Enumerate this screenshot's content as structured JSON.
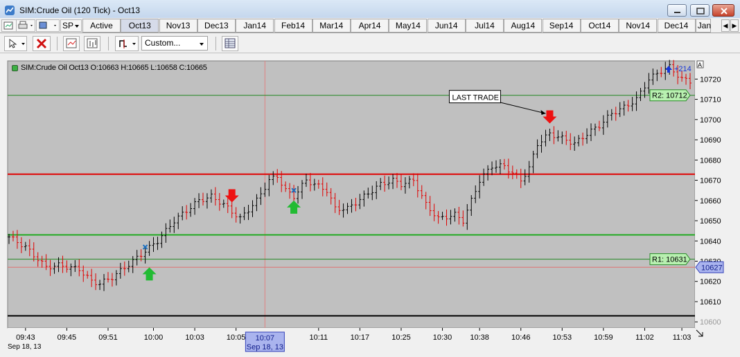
{
  "window": {
    "title": "SIM:Crude Oil (120 Tick) - Oct13"
  },
  "tabs": {
    "instrument": "SP",
    "items": [
      "Active",
      "Oct13",
      "Nov13",
      "Dec13",
      "Jan14",
      "Feb14",
      "Mar14",
      "Apr14",
      "May14",
      "Jun14",
      "Jul14",
      "Aug14",
      "Sep14",
      "Oct14",
      "Nov14",
      "Dec14",
      "Jan"
    ],
    "selected": "Oct13"
  },
  "toolbar": {
    "template_select": "Custom..."
  },
  "chart_header": {
    "instrument": "SIM:Crude Oil Oct13",
    "open_label": "O:",
    "open": "10663",
    "high_label": "H:",
    "high": "10665",
    "low_label": "L:",
    "low": "10658",
    "close_label": "C:",
    "close": "10665"
  },
  "colors": {
    "background": "#c0c0c0",
    "up_bar": "#000000",
    "down_bar": "#e00000",
    "resistance_line": "#e00000",
    "support_line": "#22aa22",
    "pivot_line": "#228822",
    "buy_arrow": "#22bb33",
    "sell_arrow": "#ee1111",
    "price_marker": "#aab4ee"
  },
  "chart_data": {
    "type": "ohlc",
    "ylim": [
      10597,
      10729
    ],
    "y_ticks": [
      10600,
      10610,
      10620,
      10630,
      10640,
      10650,
      10660,
      10670,
      10680,
      10690,
      10700,
      10710,
      10720
    ],
    "x_count": 166,
    "time_ticks": [
      {
        "i": 4,
        "label": "09:43"
      },
      {
        "i": 14,
        "label": "09:45"
      },
      {
        "i": 24,
        "label": "09:51"
      },
      {
        "i": 35,
        "label": "10:00"
      },
      {
        "i": 45,
        "label": "10:03"
      },
      {
        "i": 55,
        "label": "10:05"
      },
      {
        "i": 75,
        "label": "10:11"
      },
      {
        "i": 85,
        "label": "10:17"
      },
      {
        "i": 95,
        "label": "10:25"
      },
      {
        "i": 105,
        "label": "10:30"
      },
      {
        "i": 114,
        "label": "10:38"
      },
      {
        "i": 124,
        "label": "10:46"
      },
      {
        "i": 134,
        "label": "10:53"
      },
      {
        "i": 144,
        "label": "10:59"
      },
      {
        "i": 154,
        "label": "11:02"
      },
      {
        "i": 163,
        "label": "11:03"
      }
    ],
    "date_label": "Sep 18, 13",
    "crosshair": {
      "i": 62,
      "time": "10:07",
      "date": "Sep 18, 13"
    },
    "lines": [
      {
        "name": "R2",
        "value": 10712,
        "label": "R2: 10712",
        "color": "#228822"
      },
      {
        "name": "resistance",
        "value": 10673,
        "color": "#e00000"
      },
      {
        "name": "support",
        "value": 10643,
        "color": "#22aa22"
      },
      {
        "name": "R1",
        "value": 10631,
        "label": "R1: 10631",
        "color": "#228822"
      },
      {
        "name": "crosshair",
        "value": 10627,
        "color": "#e07070"
      },
      {
        "name": "floor",
        "value": 10603,
        "color": "#000000"
      }
    ],
    "last_price": "10627",
    "pnl": "+214",
    "annotation": {
      "text": "LAST TRADE",
      "i": 107,
      "value": 10711,
      "target_i": 130,
      "target_value": 10703
    },
    "buy_arrows": [
      {
        "i": 34,
        "value": 10629
      },
      {
        "i": 69,
        "value": 10662
      }
    ],
    "sell_arrows": [
      {
        "i": 54,
        "value": 10657
      },
      {
        "i": 131,
        "value": 10696
      }
    ],
    "entry_marks": [
      {
        "i": 33,
        "value": 10637
      },
      {
        "i": 69,
        "value": 10665
      }
    ],
    "path_points": [
      [
        0,
        10642
      ],
      [
        4,
        10637
      ],
      [
        9,
        10627
      ],
      [
        12,
        10628
      ],
      [
        17,
        10626
      ],
      [
        20,
        10620
      ],
      [
        22,
        10619
      ],
      [
        25,
        10622
      ],
      [
        30,
        10630
      ],
      [
        36,
        10640
      ],
      [
        40,
        10650
      ],
      [
        43,
        10655
      ],
      [
        46,
        10660
      ],
      [
        49,
        10662
      ],
      [
        52,
        10658
      ],
      [
        56,
        10651
      ],
      [
        60,
        10660
      ],
      [
        63,
        10670
      ],
      [
        65,
        10672
      ],
      [
        67,
        10665
      ],
      [
        69,
        10662
      ],
      [
        72,
        10670
      ],
      [
        74,
        10668
      ],
      [
        77,
        10665
      ],
      [
        79,
        10656
      ],
      [
        82,
        10656
      ],
      [
        86,
        10662
      ],
      [
        90,
        10668
      ],
      [
        93,
        10670
      ],
      [
        95,
        10668
      ],
      [
        98,
        10670
      ],
      [
        101,
        10658
      ],
      [
        104,
        10651
      ],
      [
        108,
        10653
      ],
      [
        110,
        10650
      ],
      [
        112,
        10660
      ],
      [
        114,
        10670
      ],
      [
        117,
        10677
      ],
      [
        120,
        10677
      ],
      [
        124,
        10670
      ],
      [
        126,
        10676
      ],
      [
        128,
        10688
      ],
      [
        131,
        10693
      ],
      [
        135,
        10690
      ],
      [
        137,
        10688
      ],
      [
        140,
        10693
      ],
      [
        143,
        10697
      ],
      [
        146,
        10703
      ],
      [
        149,
        10706
      ],
      [
        152,
        10710
      ],
      [
        155,
        10720
      ],
      [
        158,
        10724
      ],
      [
        160,
        10726
      ],
      [
        163,
        10720
      ],
      [
        165,
        10719
      ]
    ]
  }
}
